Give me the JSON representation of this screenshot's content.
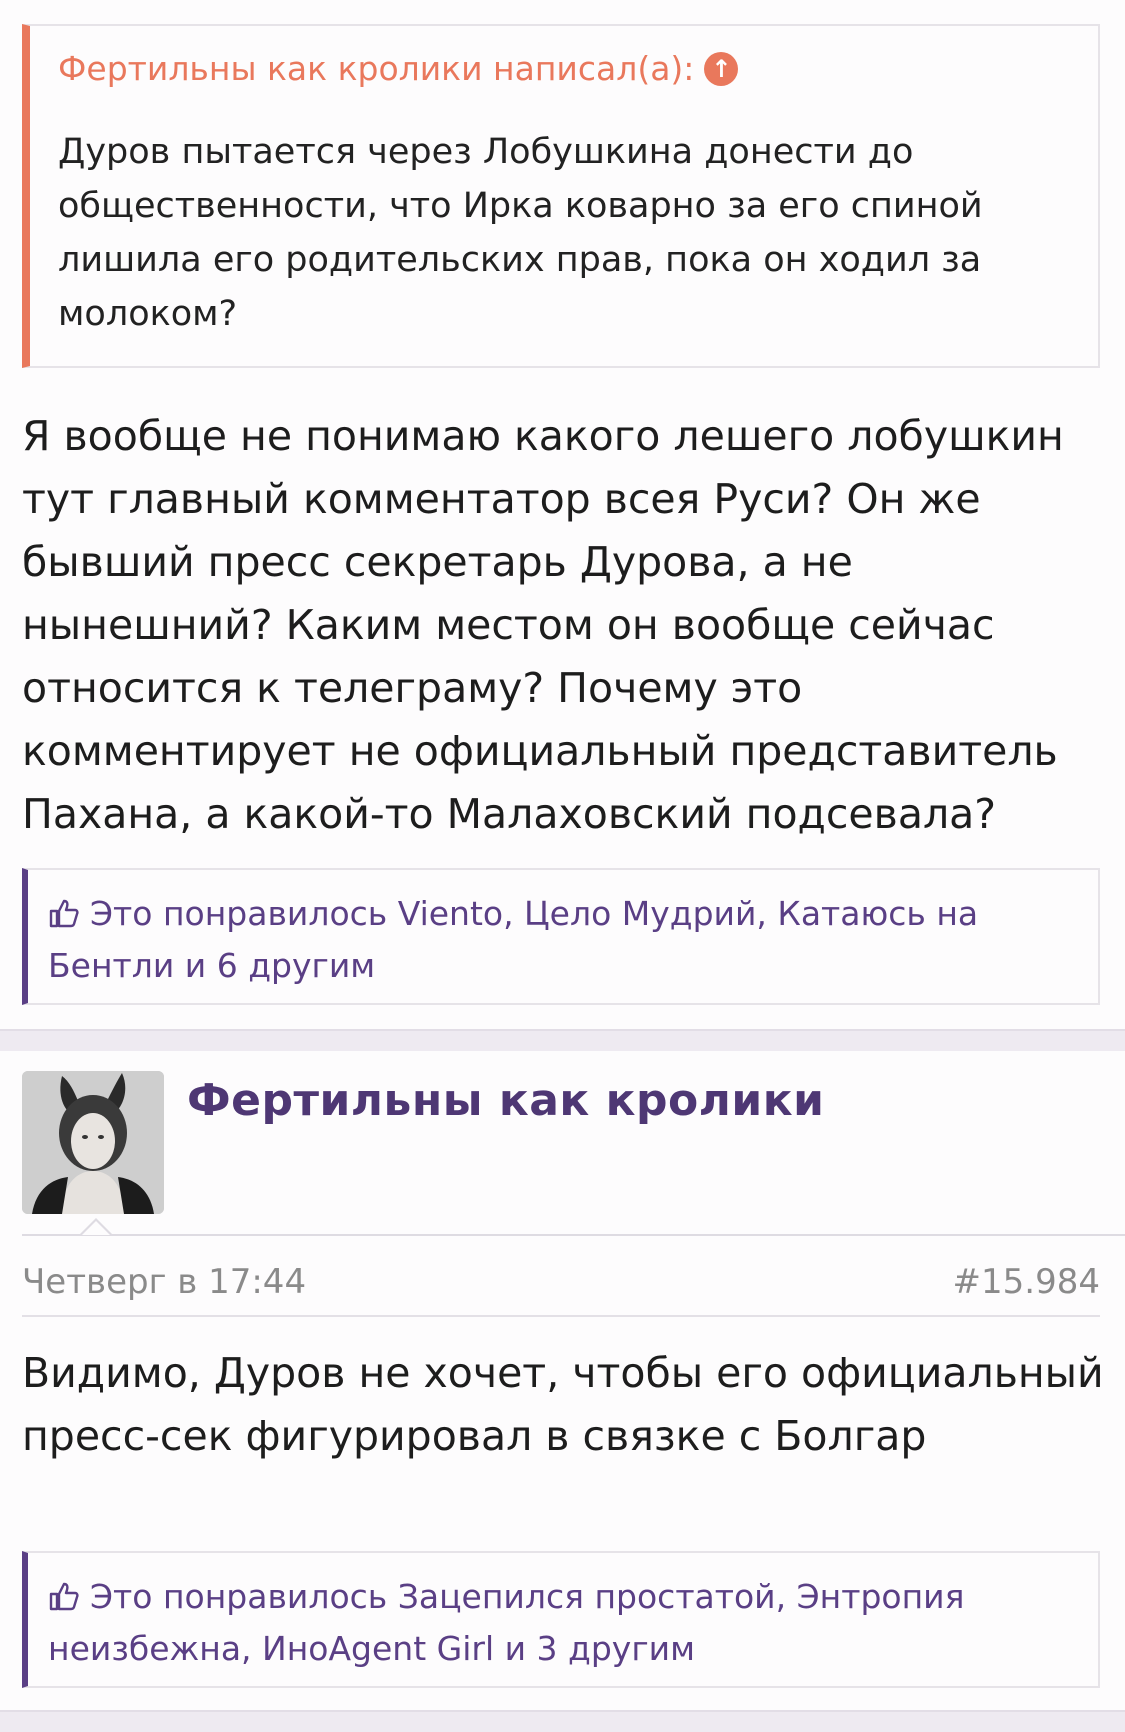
{
  "quote": {
    "author": "Фертильны как кролики написал(а):",
    "icon": "arrow-up-circle-icon",
    "text": "Дуров пытается через Лобушкина донести до общественности, что Ирка коварно за его спиной лишила его родительских прав, пока он ходил за молоком?"
  },
  "post1": {
    "text": "Я вообще не понимаю какого лешего лобушкин тут главный комментатор всея Руси? Он же бывший пресс секретарь Дурова, а не нынешний? Каким местом он вообще сейчас относится к телеграму? Почему это комментирует не официальный представитель Пахана, а какой-то Малаховский подсевала?",
    "likes": "Это понравилось Viento, Цело Мудрий, Катаюсь на Бентли и 6 другим"
  },
  "post2": {
    "author": "Фертильны как кролики",
    "date": "Четверг в 17:44",
    "number": "#15.984",
    "text": "Видимо, Дуров не хочет, чтобы его официальный пресс-сек фигурировал в связке с Болгар",
    "likes": "Это понравилось Зацепился простатой, Энтропия неизбежна, ИноAgent Girl и 3 другим"
  },
  "colors": {
    "quote_accent": "#e9785c",
    "likes_accent": "#5a3f85",
    "author": "#4e3774"
  }
}
